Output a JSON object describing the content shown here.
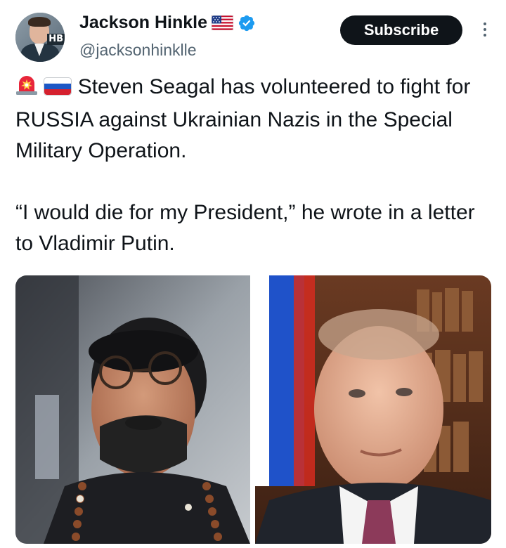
{
  "author": {
    "display_name": "Jackson Hinkle",
    "handle": "@jacksonhinklle",
    "avatar_badge_text": "HB"
  },
  "actions": {
    "subscribe_label": "Subscribe"
  },
  "tweet": {
    "paragraph_1_text": "Steven Seagal has volunteered to fight for RUSSIA against Ukrainian Nazis in the Special Military Operation.",
    "paragraph_2_text": "“I would die for my President,” he wrote in a letter to Vladimir Putin."
  },
  "icons": {
    "header": [
      "flag-us-icon",
      "verified-badge-icon",
      "more-options-icon"
    ],
    "tweet_inline": [
      "police-light-icon",
      "flag-russia-icon"
    ]
  },
  "colors": {
    "text_primary": "#0f1419",
    "text_secondary": "#536471",
    "subscribe_bg": "#0f1419",
    "verified_blue": "#1d9bf0"
  }
}
